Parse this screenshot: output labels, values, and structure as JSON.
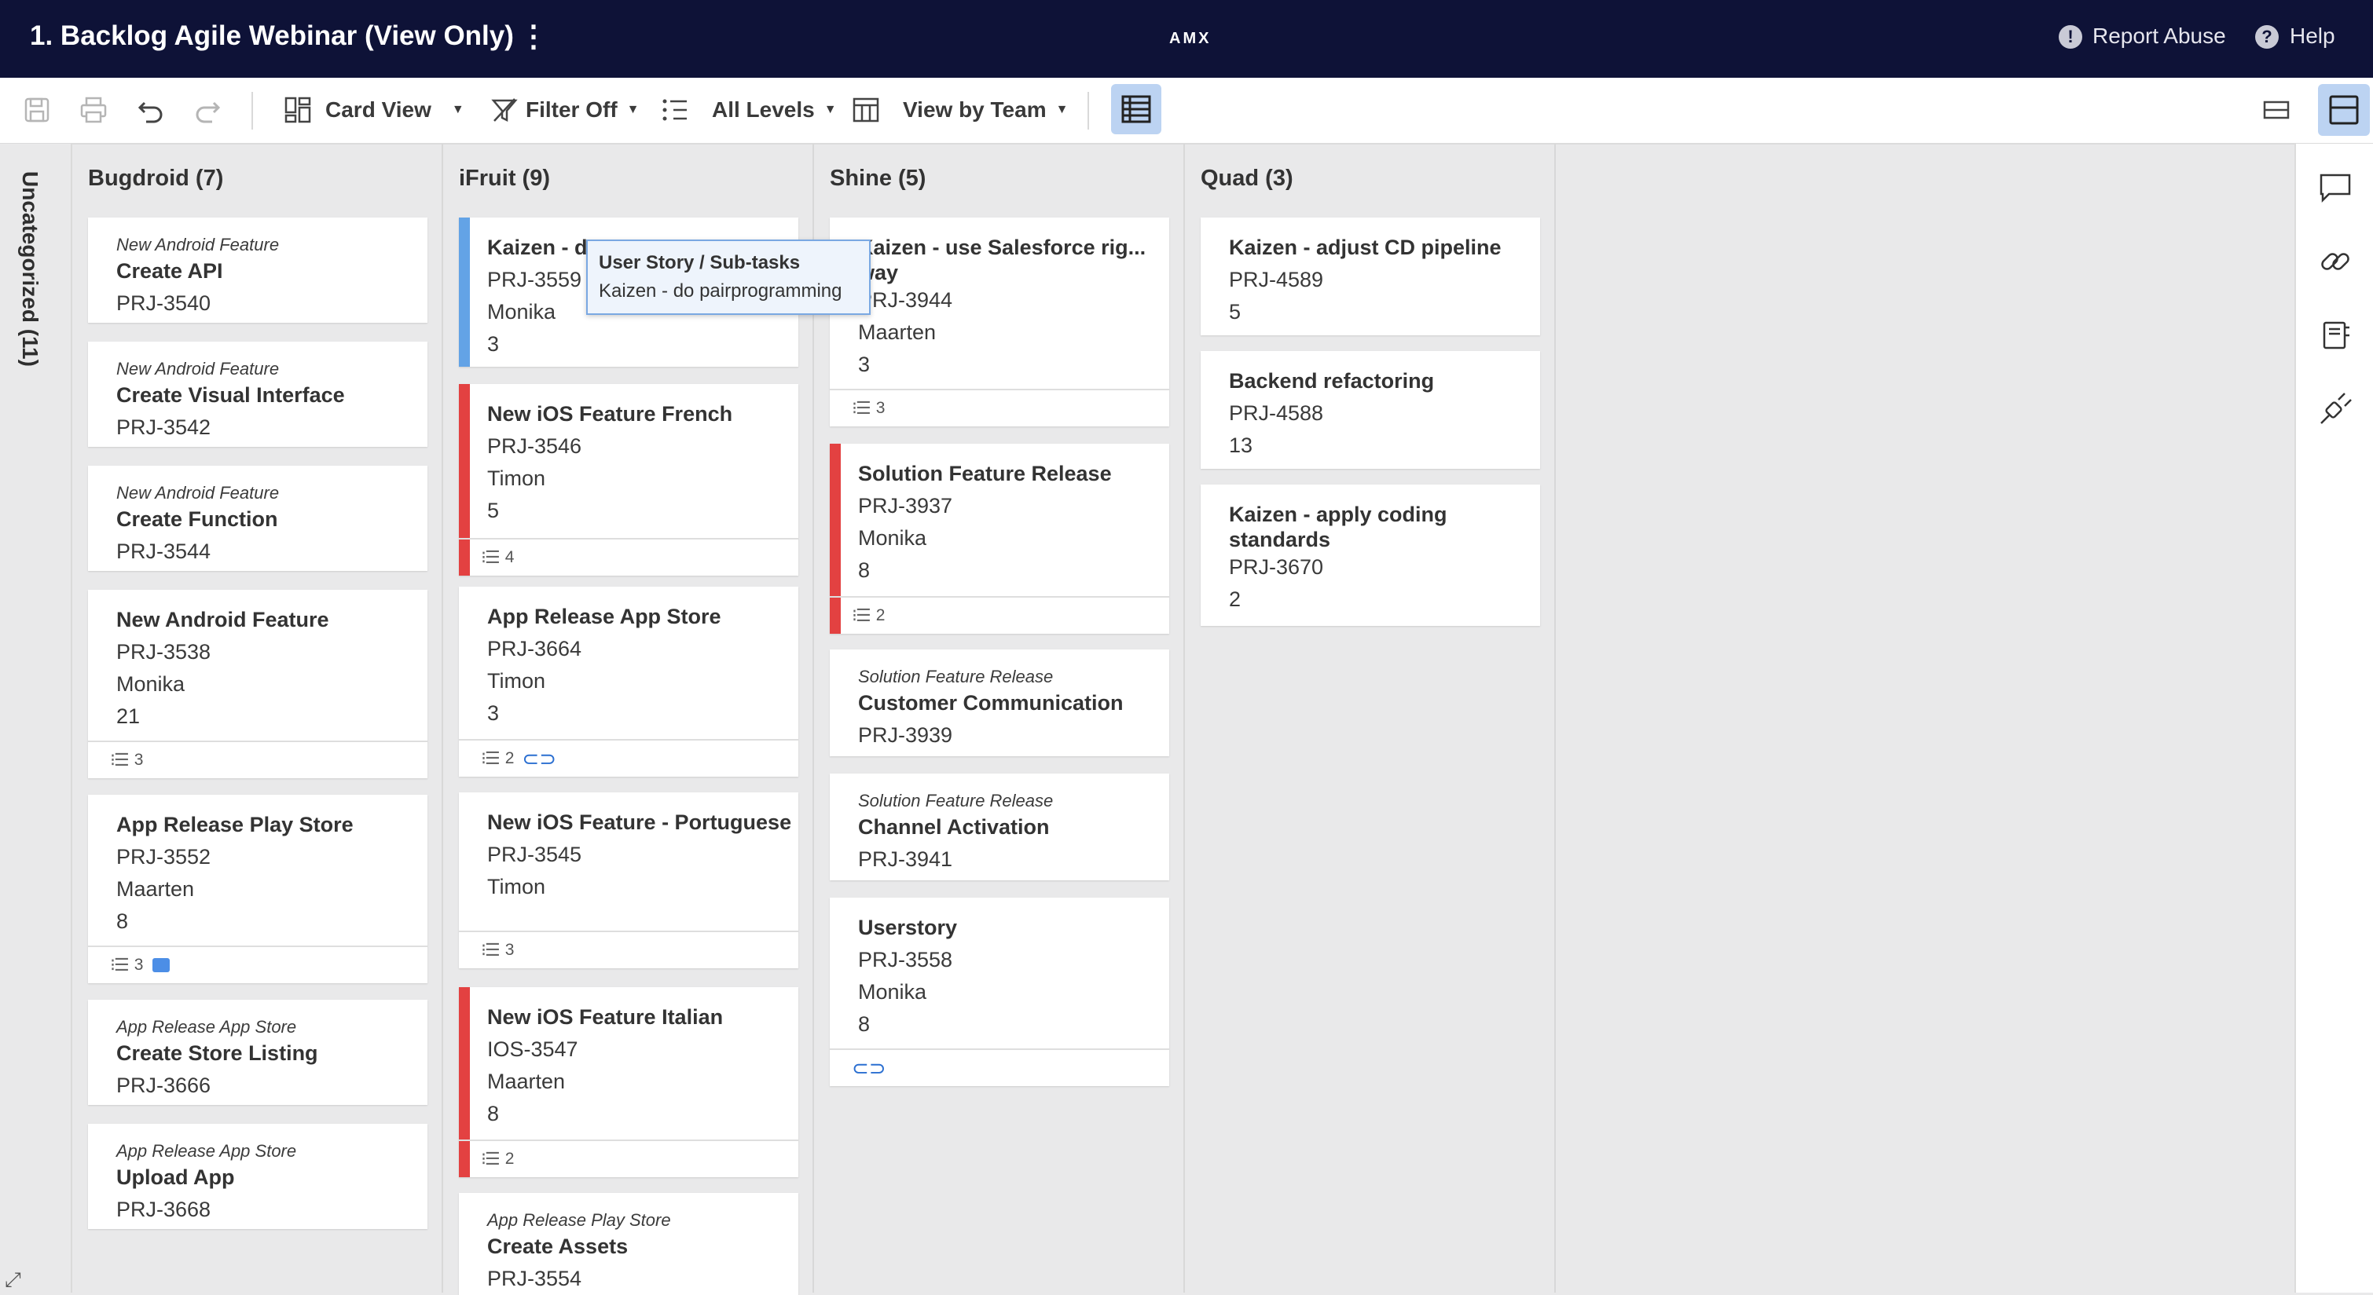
{
  "header": {
    "title": "1. Backlog Agile Webinar (View Only)",
    "menu_icon": "more-vertical-icon",
    "brand": "AMX",
    "report_abuse": "Report Abuse",
    "help": "Help"
  },
  "toolbar": {
    "card_view": "Card View",
    "filter": "Filter Off",
    "levels": "All Levels",
    "view_by": "View by Team"
  },
  "uncategorized": {
    "label": "Uncategorized (11)"
  },
  "tooltip": {
    "title": "User Story / Sub-tasks",
    "body": "Kaizen - do pairprogramming"
  },
  "columns": [
    {
      "title": "Bugdroid (7)",
      "cards": [
        {
          "parent": "New Android Feature",
          "title": "Create API",
          "id": "PRJ-3540"
        },
        {
          "parent": "New Android Feature",
          "title": "Create Visual Interface",
          "id": "PRJ-3542"
        },
        {
          "parent": "New Android Feature",
          "title": "Create Function",
          "id": "PRJ-3544"
        },
        {
          "title": "New Android Feature",
          "id": "PRJ-3538",
          "owner": "Monika",
          "points": "21",
          "subtasks": "3"
        },
        {
          "title": "App Release Play Store",
          "id": "PRJ-3552",
          "owner": "Maarten",
          "points": "8",
          "subtasks": "3"
        },
        {
          "parent": "App Release App Store",
          "title": "Create Store Listing",
          "id": "PRJ-3666"
        },
        {
          "parent": "App Release App Store",
          "title": "Upload App",
          "id": "PRJ-3668"
        }
      ]
    },
    {
      "title": "iFruit (9)",
      "cards": [
        {
          "title": "Kaizen - d",
          "id": "PRJ-3559",
          "owner": "Monika",
          "points": "3"
        },
        {
          "title": "New iOS Feature French",
          "id": "PRJ-3546",
          "owner": "Timon",
          "points": "5",
          "subtasks": "4"
        },
        {
          "title": "App Release App Store",
          "id": "PRJ-3664",
          "owner": "Timon",
          "points": "3",
          "subtasks": "2"
        },
        {
          "title": "New iOS Feature - Portuguese",
          "id": "PRJ-3545",
          "owner": "Timon",
          "subtasks": "3"
        },
        {
          "title": "New iOS Feature Italian",
          "id": "IOS-3547",
          "owner": "Maarten",
          "points": "8",
          "subtasks": "2"
        },
        {
          "parent": "App Release Play Store",
          "title": "Create Assets",
          "id": "PRJ-3554"
        }
      ]
    },
    {
      "title": "Shine (5)",
      "cards": [
        {
          "title": "Kaizen - use Salesforce rig...",
          "title2": "way",
          "id": "PRJ-3944",
          "owner": "Maarten",
          "points": "3",
          "subtasks": "3"
        },
        {
          "title": "Solution Feature Release",
          "id": "PRJ-3937",
          "owner": "Monika",
          "points": "8",
          "subtasks": "2"
        },
        {
          "parent": "Solution Feature Release",
          "title": "Customer Communication",
          "id": "PRJ-3939"
        },
        {
          "parent": "Solution Feature Release",
          "title": "Channel Activation",
          "id": "PRJ-3941"
        },
        {
          "title": "Userstory",
          "id": "PRJ-3558",
          "owner": "Monika",
          "points": "8"
        }
      ]
    },
    {
      "title": "Quad (3)",
      "cards": [
        {
          "title": "Kaizen - adjust CD pipeline",
          "id": "PRJ-4589",
          "points": "5"
        },
        {
          "title": "Backend refactoring",
          "id": "PRJ-4588",
          "points": "13"
        },
        {
          "title": "Kaizen - apply coding standards",
          "id": "PRJ-3670",
          "points": "2"
        }
      ]
    }
  ],
  "colors": {
    "header_bg": "#0e1237",
    "accent_red": "#e34141",
    "accent_blue": "#63a3e6",
    "active_tool": "#bcd3f2"
  }
}
